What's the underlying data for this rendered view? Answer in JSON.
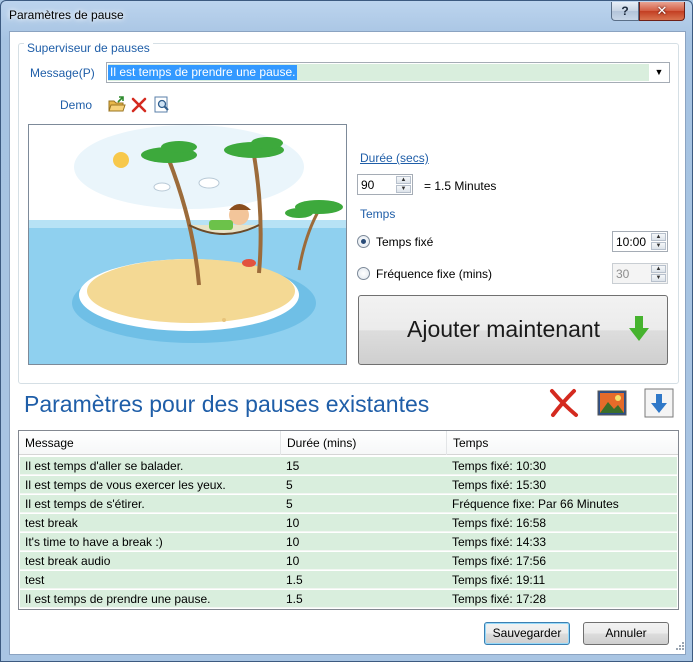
{
  "window": {
    "title": "Paramètres de pause",
    "help_label": "?",
    "close_label": "✕"
  },
  "supervisor": {
    "legend": "Superviseur de pauses",
    "message_label": "Message(P)",
    "message_value": "Il est temps de prendre une pause.",
    "demo_label": "Demo",
    "demo_icons": [
      "open-folder-icon",
      "delete-icon",
      "preview-icon"
    ]
  },
  "duration": {
    "label": "Durée (secs)",
    "value": "90",
    "equivalent": "= 1.5 Minutes"
  },
  "time": {
    "label": "Temps",
    "fixed_label": "Temps fixé",
    "fixed_value": "10:00",
    "frequency_label": "Fréquence fixe (mins)",
    "frequency_value": "30",
    "selected": "fixed"
  },
  "add_button": {
    "label": "Ajouter maintenant",
    "icon": "green-down-arrow-icon"
  },
  "existing": {
    "title": "Paramètres pour des pauses existantes",
    "toolbar_icons": [
      "delete-icon",
      "image-icon",
      "download-icon"
    ],
    "columns": [
      "Message",
      "Durée (mins)",
      "Temps"
    ],
    "rows": [
      {
        "message": "Il est temps d'aller se balader.",
        "duration": "15",
        "time": "Temps fixé: 10:30"
      },
      {
        "message": "Il est temps de vous exercer les yeux.",
        "duration": "5",
        "time": "Temps fixé: 15:30"
      },
      {
        "message": "Il est temps de s'étirer.",
        "duration": "5",
        "time": "Fréquence fixe: Par 66 Minutes"
      },
      {
        "message": "test break",
        "duration": "10",
        "time": "Temps fixé: 16:58"
      },
      {
        "message": "It's time to have a break :)",
        "duration": "10",
        "time": "Temps fixé: 14:33"
      },
      {
        "message": "test break audio",
        "duration": "10",
        "time": "Temps fixé: 17:56"
      },
      {
        "message": "test",
        "duration": "1.5",
        "time": "Temps fixé: 19:11"
      },
      {
        "message": "Il est temps de prendre une pause.",
        "duration": "1.5",
        "time": "Temps fixé: 17:28"
      }
    ]
  },
  "footer": {
    "save_label": "Sauvegarder",
    "cancel_label": "Annuler"
  },
  "colors": {
    "accent_text": "#1f5ea8",
    "row_background": "#d9eedd",
    "selection": "#3399ff",
    "delete_red": "#d42a1f",
    "arrow_green": "#46b32e"
  }
}
